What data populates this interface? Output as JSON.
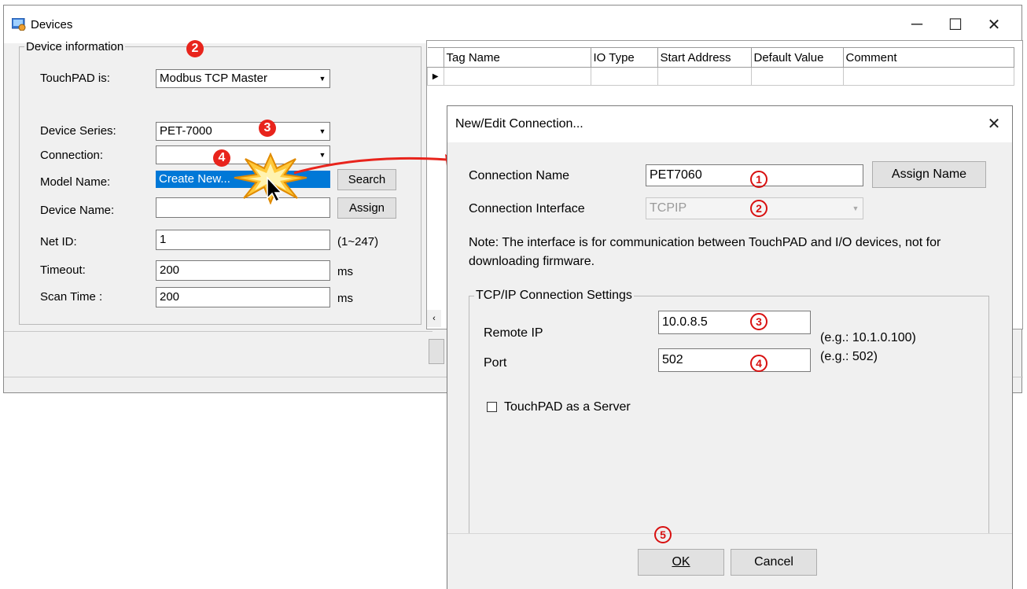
{
  "devices_window": {
    "title": "Devices",
    "minimize_label": "─",
    "maximize_label": "☐",
    "close_label": "✕"
  },
  "device_info": {
    "legend": "Device information",
    "touchpad_label": "TouchPAD is:",
    "touchpad_value": "Modbus TCP Master",
    "series_label": "Device Series:",
    "series_value": "PET-7000",
    "connection_label": "Connection:",
    "connection_value": "",
    "connection_option": "Create New...",
    "model_label": "Model Name:",
    "search_button": "Search",
    "device_name_label": "Device Name:",
    "assign_button": "Assign",
    "netid_label": "Net ID:",
    "netid_value": "1",
    "netid_hint": "(1~247)",
    "timeout_label": "Timeout:",
    "timeout_value": "200",
    "timeout_unit": "ms",
    "scan_label": "Scan Time :",
    "scan_value": "200",
    "scan_unit": "ms"
  },
  "tag_table": {
    "columns": [
      "Tag Name",
      "IO Type",
      "Start Address",
      "Default Value",
      "Comment"
    ]
  },
  "badges": {
    "b2": "2",
    "b3": "3",
    "b4": "4"
  },
  "connection_dialog": {
    "title": "New/Edit Connection...",
    "close_label": "✕",
    "name_label": "Connection Name",
    "name_value": "PET7060",
    "assign_name_button": "Assign Name",
    "interface_label": "Connection Interface",
    "interface_value": "TCPIP",
    "note": "Note: The interface is for communication between TouchPAD and I/O devices, not for downloading firmware.",
    "tcp_legend": "TCP/IP Connection Settings",
    "remote_ip_label": "Remote IP",
    "remote_ip_value": "10.0.8.5",
    "remote_ip_hint": "(e.g.: 10.1.0.100)",
    "port_label": "Port",
    "port_value": "502",
    "port_hint": "(e.g.: 502)",
    "server_checkbox_label": "TouchPAD as a Server",
    "server_checked": false,
    "ok_button": "OK",
    "cancel_button": "Cancel"
  },
  "markers": {
    "m1": "1",
    "m2": "2",
    "m3": "3",
    "m4": "4",
    "m5": "5"
  },
  "colors": {
    "accent_red": "#e8241c",
    "selection_blue": "#0078d7"
  }
}
